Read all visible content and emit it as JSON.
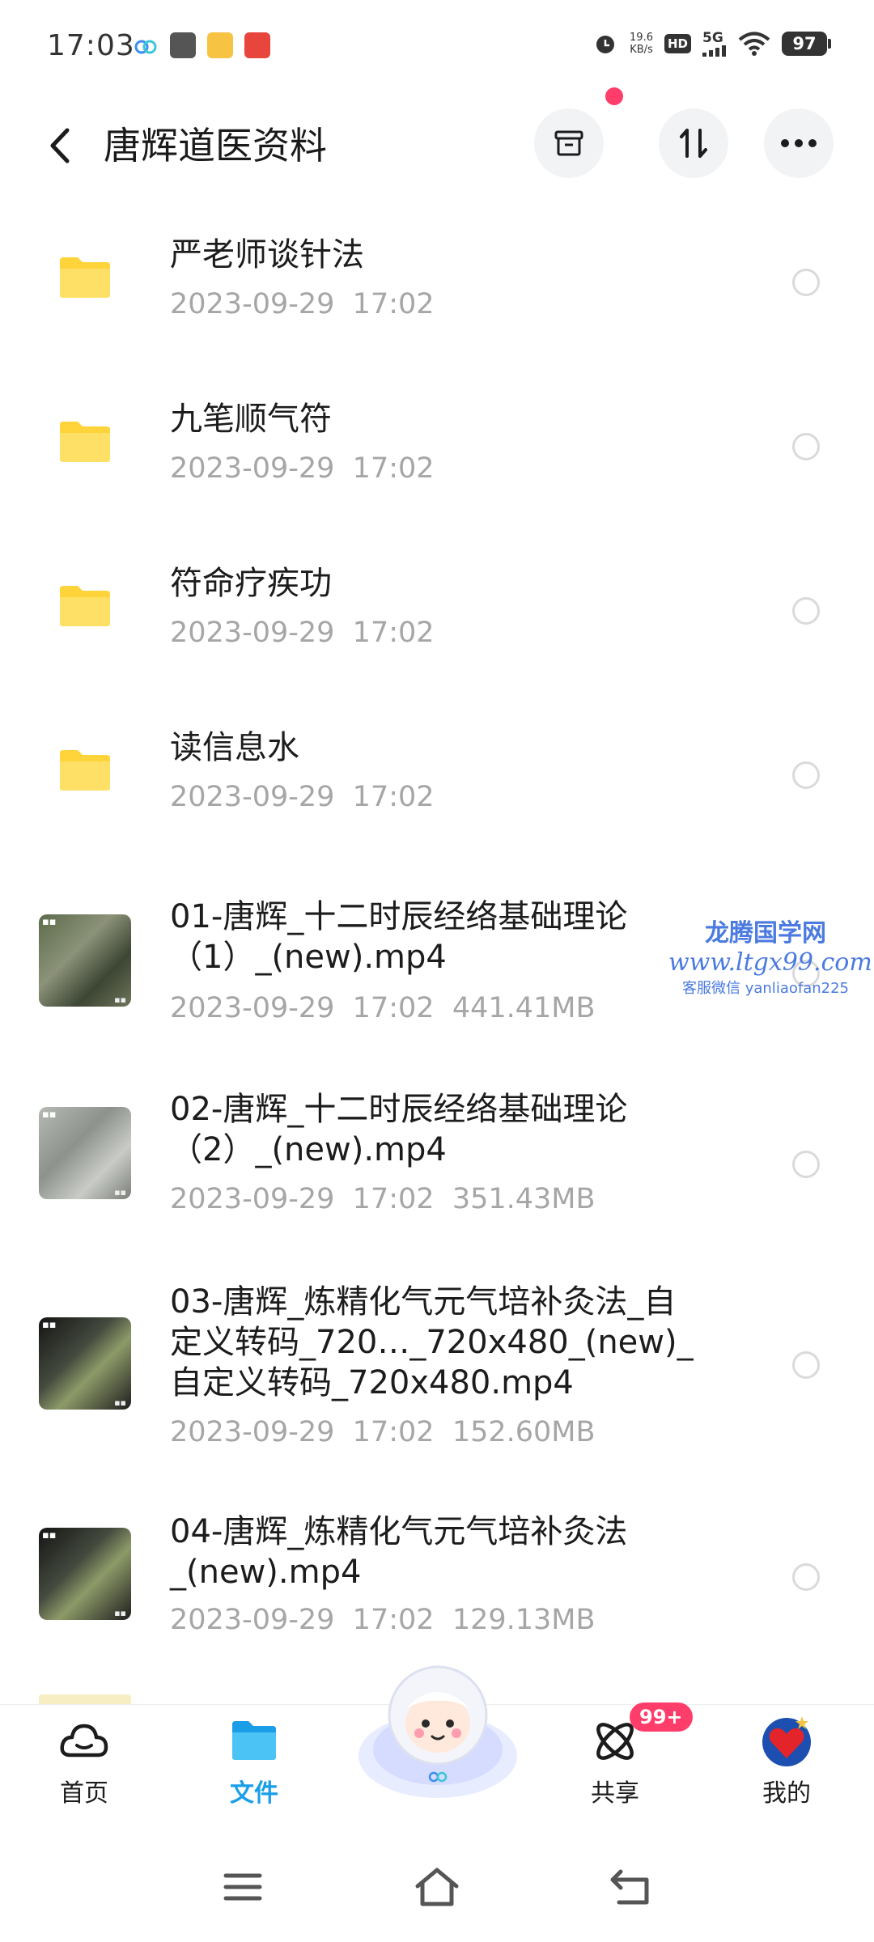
{
  "status_bar": {
    "time": "17:03",
    "net_speed_value": "19.6",
    "net_speed_unit": "KB/s",
    "hd": "HD",
    "network": "5G",
    "battery": "97",
    "icons": [
      "cloud-app-icon",
      "notification-square-icon",
      "weibo-icon",
      "app-red-icon",
      "alarm-icon",
      "wifi-icon",
      "signal-icon"
    ]
  },
  "header": {
    "title": "唐辉道医资料",
    "back_icon": "chevron-left-icon",
    "actions": [
      "archive-icon",
      "sort-icon",
      "more-icon"
    ]
  },
  "files": [
    {
      "type": "folder",
      "name": "严老师谈针法",
      "date": "2023-09-29",
      "time": "17:02",
      "size": ""
    },
    {
      "type": "folder",
      "name": "九笔顺气符",
      "date": "2023-09-29",
      "time": "17:02",
      "size": ""
    },
    {
      "type": "folder",
      "name": "符命疗疾功",
      "date": "2023-09-29",
      "time": "17:02",
      "size": ""
    },
    {
      "type": "folder",
      "name": "读信息水",
      "date": "2023-09-29",
      "time": "17:02",
      "size": ""
    },
    {
      "type": "video",
      "name_line1": "01-唐辉_十二时辰经络基础理论",
      "name_line2": "（1）_(new).mp4",
      "date": "2023-09-29",
      "time": "17:02",
      "size": "441.41MB"
    },
    {
      "type": "video",
      "name_line1": "02-唐辉_十二时辰经络基础理论",
      "name_line2": "（2）_(new).mp4",
      "date": "2023-09-29",
      "time": "17:02",
      "size": "351.43MB"
    },
    {
      "type": "video",
      "name_line1": "03-唐辉_炼精化气元气培补灸法_自",
      "name_line2": "定义转码_720…_720x480_(new)_",
      "name_line3": "自定义转码_720x480.mp4",
      "date": "2023-09-29",
      "time": "17:02",
      "size": "152.60MB"
    },
    {
      "type": "video",
      "name_line1": "04-唐辉_炼精化气元气培补灸法",
      "name_line2": "_(new).mp4",
      "date": "2023-09-29",
      "time": "17:02",
      "size": "129.13MB"
    }
  ],
  "watermark": {
    "line1": "龙腾国学网",
    "line2": "www.ltgx99.com",
    "line3": "客服微信 yanliaofan225"
  },
  "bottom_nav": {
    "items": [
      {
        "label": "首页",
        "icon": "cloud-home-icon",
        "active": false
      },
      {
        "label": "文件",
        "icon": "folder-icon",
        "active": true
      },
      {
        "label": "共享",
        "icon": "atom-share-icon",
        "active": false,
        "badge": "99+"
      },
      {
        "label": "我的",
        "icon": "avatar-heart-icon",
        "active": false
      }
    ]
  },
  "colors": {
    "accent": "#1a9ee8",
    "folder": "#ffd43b",
    "badge": "#ff3d6a",
    "meta_text": "#a6a6a6"
  }
}
